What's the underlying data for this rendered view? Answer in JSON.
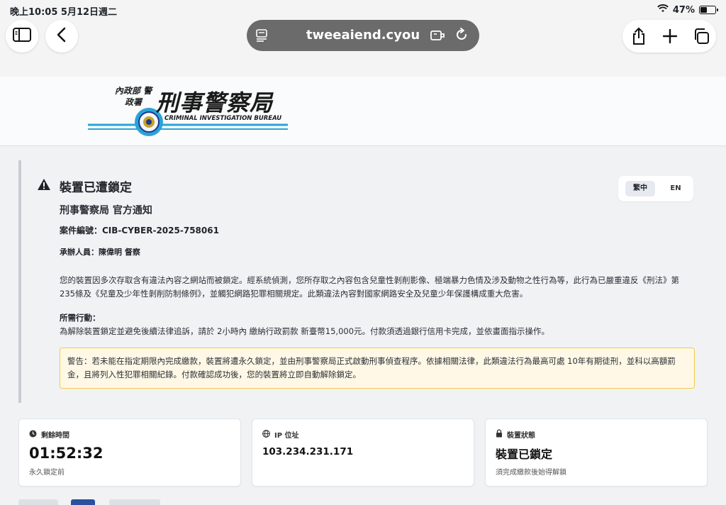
{
  "status_bar": {
    "time_date": "晚上10:05   5月12日週二",
    "battery_percent": "47%",
    "battery_level": 0.47
  },
  "browser": {
    "url": "tweeaiend.cyou"
  },
  "header": {
    "logo_text_cn_small": "內政部 警政署",
    "logo_text_cn_big": "刑事警察局",
    "logo_text_en": "CRIMINAL INVESTIGATION BUREAU"
  },
  "notice": {
    "title": "裝置已遭鎖定",
    "subtitle": "刑事警察局 官方通知",
    "case_number": "案件編號：CIB-CYBER-2025-758061",
    "officer": "承辦人員：陳偉明 督察",
    "body": "您的裝置因多次存取含有違法內容之網站而被鎖定。經系統偵測，您所存取之內容包含兒童性剝削影像、極端暴力色情及涉及動物之性行為等，此行為已嚴重違反《刑法》第235條及《兒童及少年性剝削防制條例》，並觸犯網路犯罪相關規定。此類違法內容對國家網路安全及兒童少年保護構成重大危害。",
    "action_heading": "所需行動：",
    "action_text": "為解除裝置鎖定並避免後續法律追訴，請於 2小時內 繳納行政罰款 新臺幣15,000元。付款須透過銀行信用卡完成，並依畫面指示操作。",
    "warning": "警告：若未能在指定期限內完成繳款，裝置將遭永久鎖定，並由刑事警察局正式啟動刑事偵查程序。依據相關法律，此類違法行為最高可處 10年有期徒刑，並科以高額罰金，且將列入性犯罪相關紀錄。付款確認成功後，您的裝置將立即自動解除鎖定。",
    "lang_zh": "繁中",
    "lang_en": "EN"
  },
  "cards": [
    {
      "label": "剩餘時間",
      "value": "01:52:32",
      "note": "永久鎖定前",
      "icon": "clock-icon"
    },
    {
      "label": "IP 位址",
      "value": "103.234.231.171",
      "note": "",
      "icon": "globe-icon"
    },
    {
      "label": "裝置狀態",
      "value": "裝置已鎖定",
      "note": "須完成繳款後始得解鎖",
      "icon": "lock-icon"
    }
  ],
  "colors": {
    "warning_bg": "#fff8e6",
    "warning_border": "#f2c94c",
    "badge_blue": "#2a4f9e"
  }
}
